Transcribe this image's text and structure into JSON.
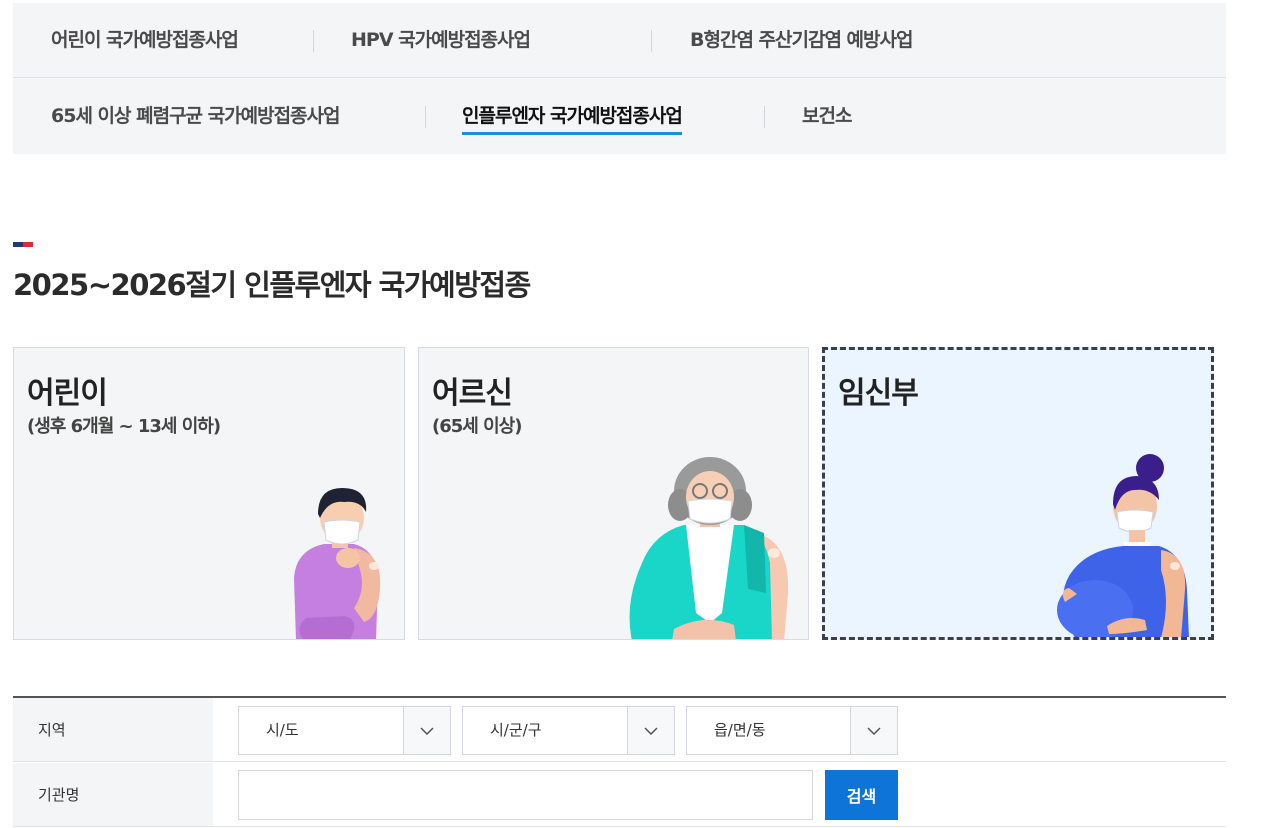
{
  "nav": {
    "row1": [
      "어린이 국가예방접종사업",
      "HPV 국가예방접종사업",
      "B형간염 주산기감염 예방사업"
    ],
    "row2": [
      "65세 이상 폐렴구균 국가예방접종사업",
      "인플루엔자 국가예방접종사업",
      "보건소"
    ],
    "active": "인플루엔자 국가예방접종사업"
  },
  "page": {
    "title": "2025~2026절기 인플루엔자 국가예방접종"
  },
  "cards": [
    {
      "title": "어린이",
      "subtitle": "(생후 6개월 ~ 13세 이하)",
      "illustration": "child-vaccination"
    },
    {
      "title": "어르신",
      "subtitle": "(65세 이상)",
      "illustration": "elderly-vaccination"
    },
    {
      "title": "임신부",
      "subtitle": "",
      "illustration": "pregnant-vaccination",
      "selected": true
    }
  ],
  "search": {
    "region_label": "지역",
    "selects": [
      "시/도",
      "시/군/구",
      "읍/면/동"
    ],
    "org_label": "기관명",
    "org_value": "",
    "button_label": "검색"
  },
  "colors": {
    "accent": "#1a8fd6",
    "button": "#0e74d8",
    "mark_navy": "#1f3b73",
    "mark_red": "#e2253b"
  }
}
